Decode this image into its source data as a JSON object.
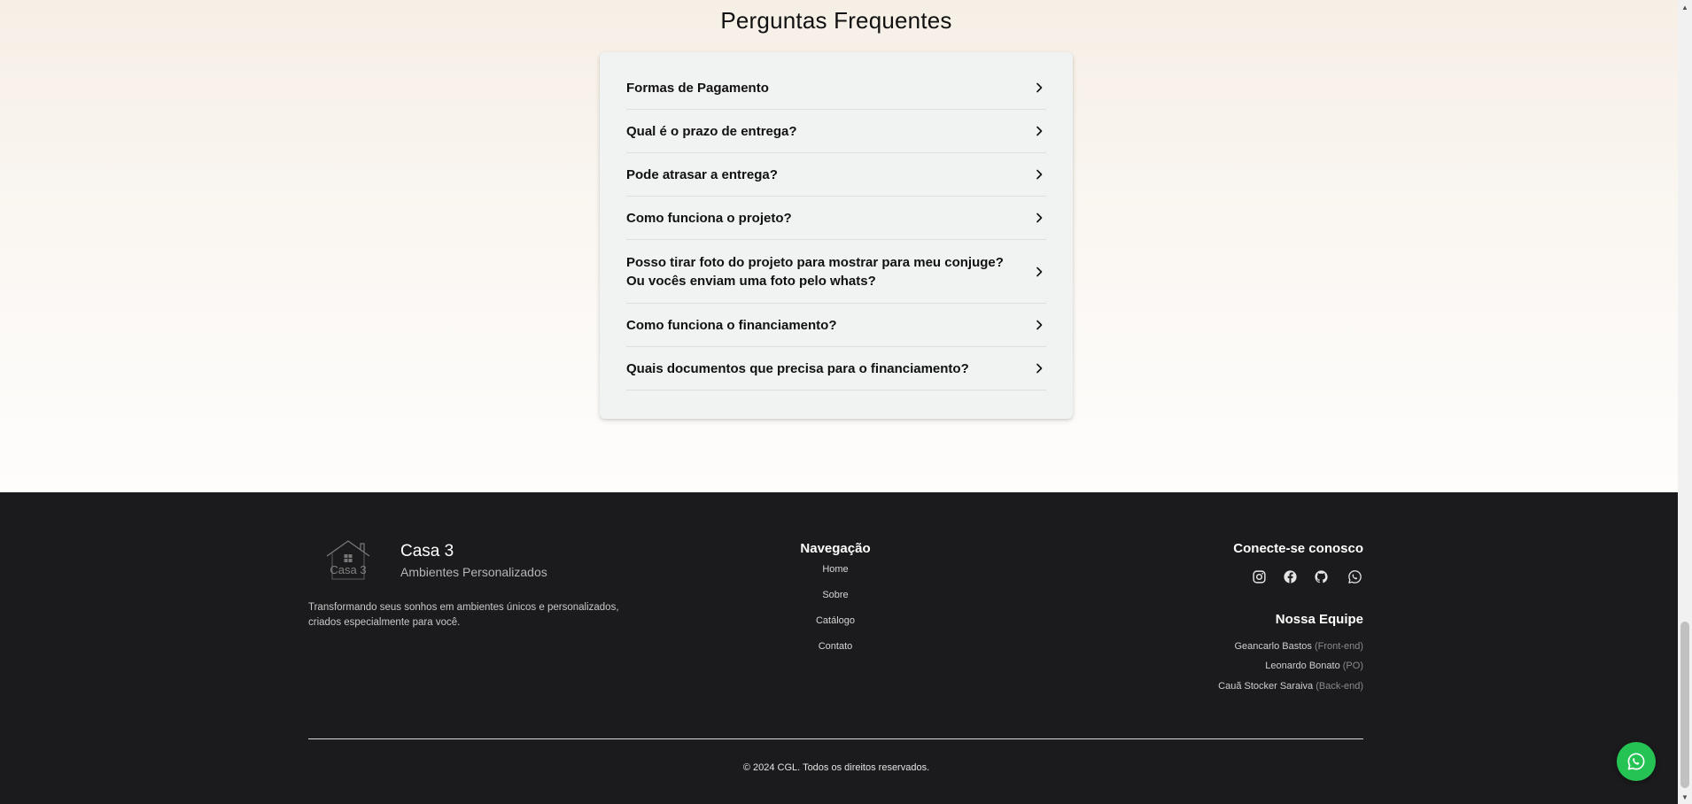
{
  "faq": {
    "title": "Perguntas Frequentes",
    "items": [
      {
        "question": "Formas de Pagamento"
      },
      {
        "question": "Qual é o prazo de entrega?"
      },
      {
        "question": "Pode atrasar a entrega?"
      },
      {
        "question": "Como funciona o projeto?"
      },
      {
        "question": "Posso tirar foto do projeto para mostrar para meu conjuge? Ou vocês enviam uma foto pelo whats?"
      },
      {
        "question": "Como funciona o financiamento?"
      },
      {
        "question": "Quais documentos que precisa para o financiamento?"
      }
    ]
  },
  "footer": {
    "brand": {
      "logo_text": "Casa 3",
      "name": "Casa 3",
      "subtitle": "Ambientes Personalizados",
      "description": "Transformando seus sonhos em ambientes únicos e personalizados, criados especialmente para você."
    },
    "navigation": {
      "title": "Navegação",
      "links": [
        "Home",
        "Sobre",
        "Catálogo",
        "Contato"
      ]
    },
    "connect": {
      "title": "Conecte-se conosco",
      "icons": [
        "instagram-icon",
        "facebook-icon",
        "github-icon",
        "whatsapp-icon"
      ]
    },
    "team": {
      "title": "Nossa Equipe",
      "members": [
        {
          "name": "Geancarlo Bastos",
          "role": "(Front-end)"
        },
        {
          "name": "Leonardo Bonato",
          "role": "(PO)"
        },
        {
          "name": "Cauã Stocker Saraiva",
          "role": "(Back-end)"
        }
      ]
    },
    "copyright": "© 2024 CGL. Todos os direitos reservados."
  },
  "floating_button": {
    "icon": "whatsapp-icon",
    "color": "#25c254"
  },
  "colors": {
    "footer_bg": "#1b1b1d",
    "faq_card_bg": "#f1f3f2",
    "whatsapp_green": "#25c254"
  }
}
